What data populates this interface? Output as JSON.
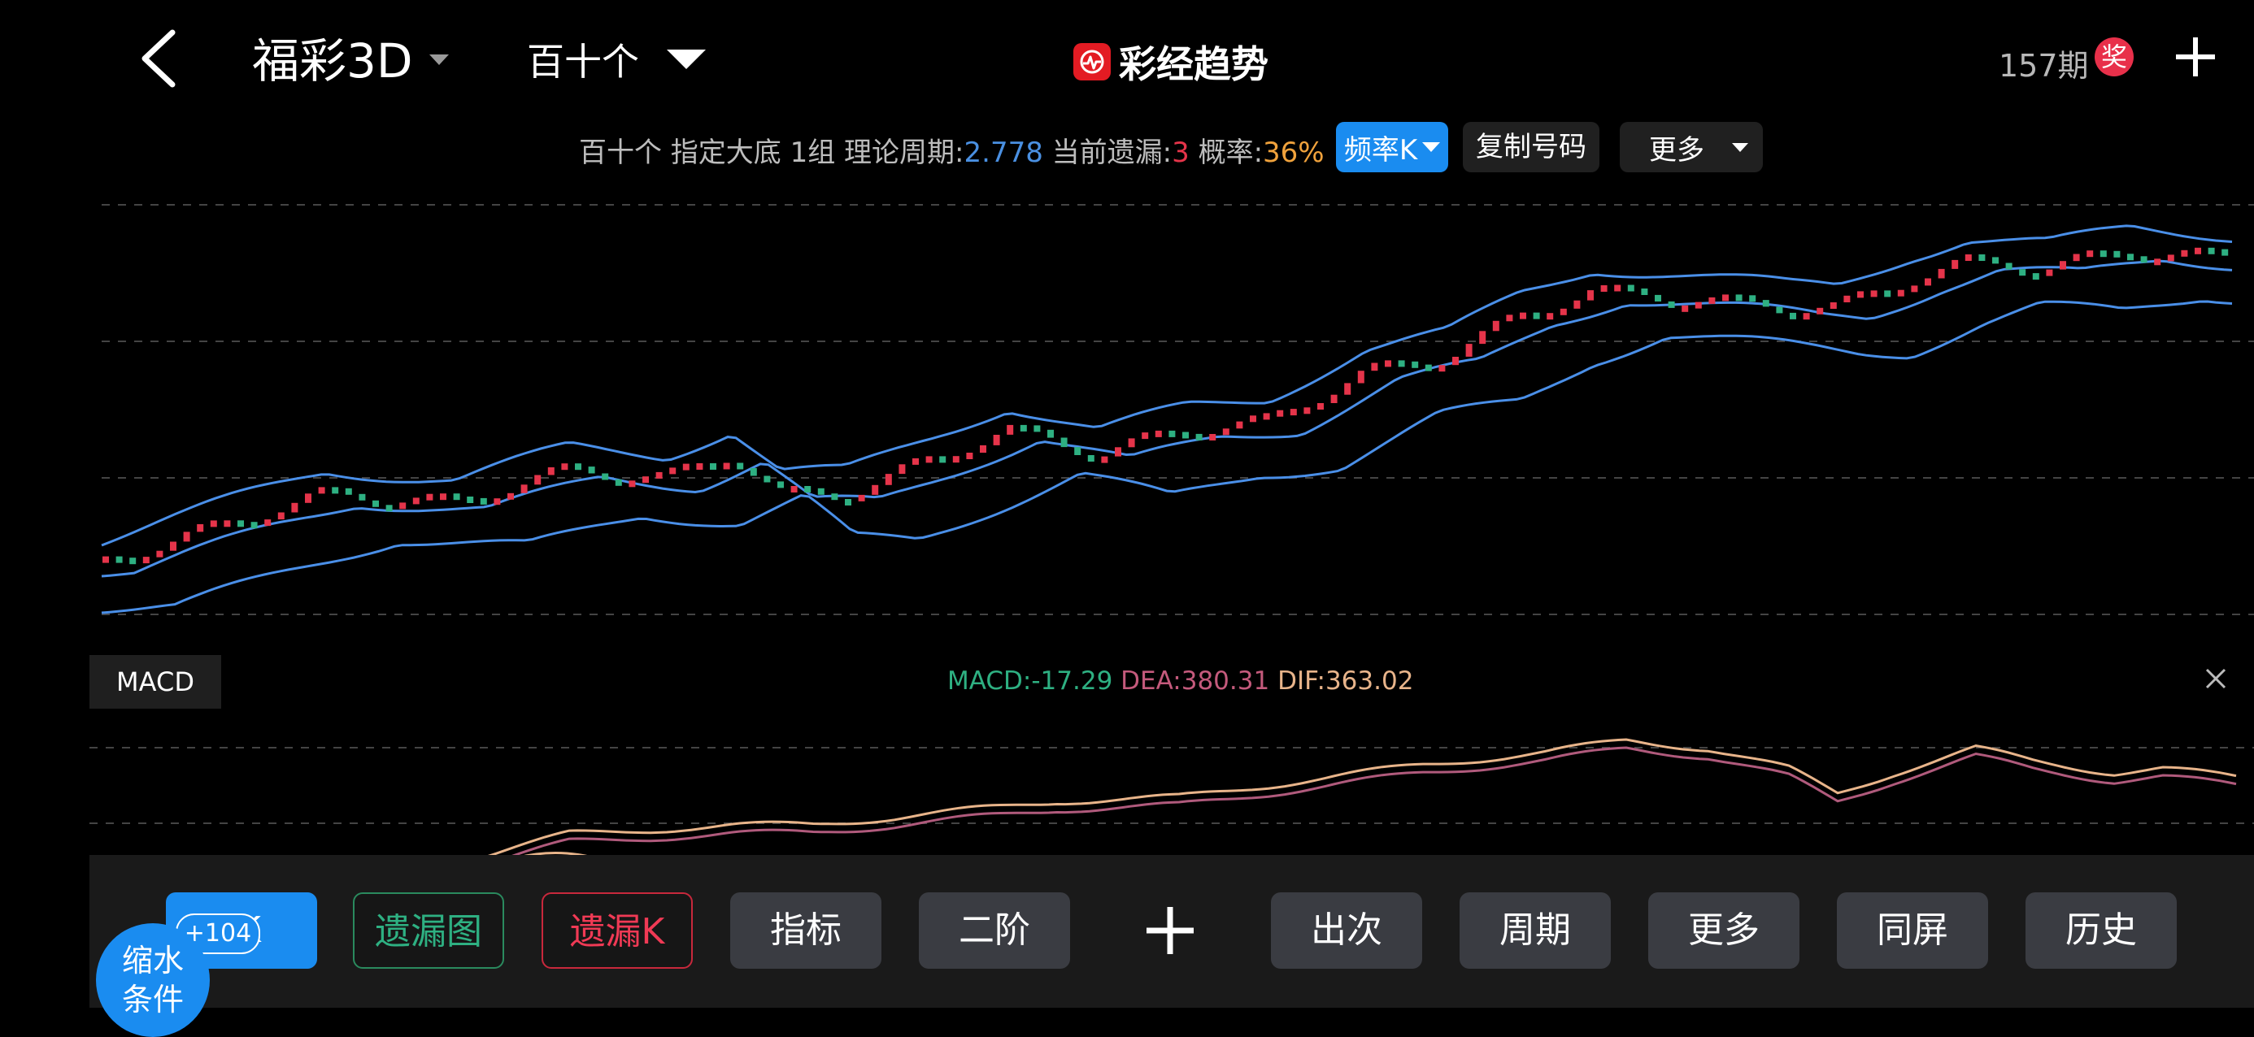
{
  "header": {
    "lottery_title": "福彩3D",
    "position_select": "百十个",
    "brand_name": "彩经趋势",
    "issue_count": "157期",
    "prize_badge": "奖"
  },
  "info": {
    "prefix": "百十个 指定大底 1组 理论周期:",
    "period_value": "2.778",
    "miss_label": " 当前遗漏:",
    "miss_value": "3",
    "prob_label": " 概率:",
    "prob_value": "36%",
    "freq_button": "频率K",
    "copy_button": "复制号码",
    "more_button": "更多"
  },
  "macd": {
    "tab_label": "MACD",
    "macd_text": "MACD:-17.29",
    "dea_text": "DEA:380.31",
    "dif_text": "DIF:363.02"
  },
  "toolbar": {
    "btn_k": "K",
    "btn_miss_chart": "遗漏图",
    "btn_miss_k": "遗漏K",
    "btn_indicator": "指标",
    "btn_second_order": "二阶",
    "btn_appearances": "出次",
    "btn_period": "周期",
    "btn_more": "更多",
    "btn_same_screen": "同屏",
    "btn_history": "历史",
    "badge_count": "+104",
    "shrink_line1": "缩水",
    "shrink_line2": "条件"
  },
  "colors": {
    "up": "#e5344a",
    "down": "#2eb082",
    "band": "#4a8fe8",
    "dea": "#b05a7c",
    "dif": "#e8b48a",
    "accent": "#1a8cf0"
  },
  "icons": [
    "back-arrow-icon",
    "caret-down-icon",
    "trend-logo-icon",
    "plus-icon",
    "close-icon"
  ],
  "chart_data": {
    "type": "candlestick",
    "description_series": [
      "candles",
      "upper-band",
      "middle-band",
      "lower-band",
      "dif",
      "dea"
    ],
    "candles_count": 158,
    "trend": "rising",
    "macd": {
      "macd": -17.29,
      "dea": 380.31,
      "dif": 363.02
    }
  }
}
